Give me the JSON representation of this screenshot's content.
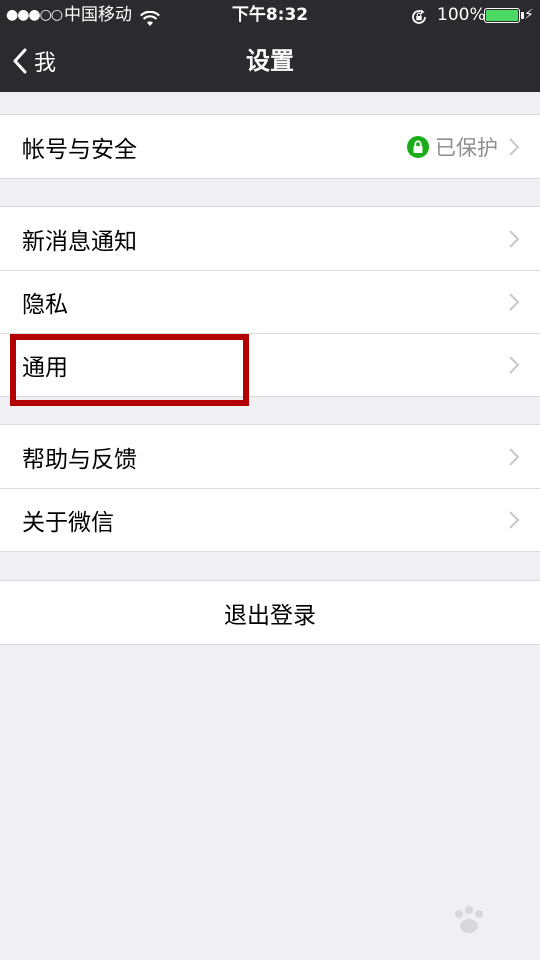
{
  "status_bar": {
    "signal": "●●●○○",
    "carrier": "中国移动",
    "time": "下午8:32",
    "battery_percent": "100%",
    "battery_level": 1.0
  },
  "nav": {
    "back_label": "我",
    "title": "设置"
  },
  "groups": [
    {
      "rows": [
        {
          "label": "帐号与安全",
          "value": "已保护"
        }
      ]
    },
    {
      "rows": [
        {
          "label": "新消息通知"
        },
        {
          "label": "隐私"
        },
        {
          "label": "通用"
        }
      ]
    },
    {
      "rows": [
        {
          "label": "帮助与反馈"
        },
        {
          "label": "关于微信"
        }
      ]
    },
    {
      "rows": [
        {
          "label": "退出登录"
        }
      ]
    }
  ],
  "colors": {
    "nav_background": "#2b2b2f",
    "page_background": "#efeff4",
    "lock_badge": "#1aad19",
    "highlight_box": "#b30000",
    "battery_fill": "#4cd964"
  },
  "icons": {
    "back": "chevron-left-icon",
    "lock": "lock-icon",
    "disclosure": "chevron-right-icon",
    "wifi": "wifi-icon",
    "orientation_lock": "orientation-lock-icon",
    "charging": "lightning-icon"
  }
}
